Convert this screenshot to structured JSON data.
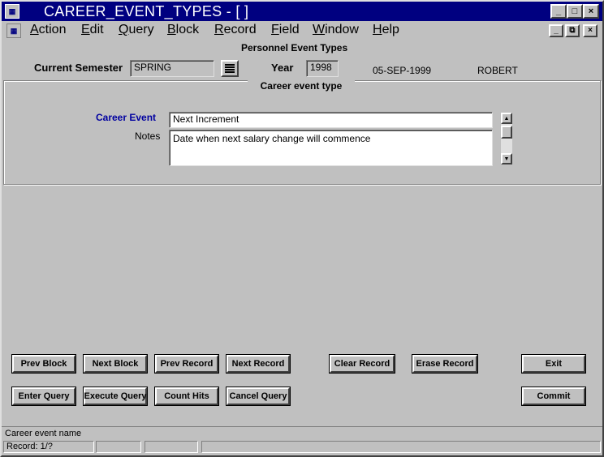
{
  "window": {
    "title": "CAREER_EVENT_TYPES - [ ]",
    "icon": "oracle-forms-icon",
    "controls": [
      "_",
      "□",
      "×"
    ]
  },
  "menubar": {
    "items": [
      {
        "accel": "A",
        "rest": "ction"
      },
      {
        "accel": "E",
        "rest": "dit"
      },
      {
        "accel": "Q",
        "rest": "uery"
      },
      {
        "accel": "B",
        "rest": "lock"
      },
      {
        "accel": "R",
        "rest": "ecord"
      },
      {
        "accel": "F",
        "rest": "ield"
      },
      {
        "accel": "W",
        "rest": "indow"
      },
      {
        "accel": "H",
        "rest": "elp"
      }
    ],
    "doc_controls": [
      "_",
      "⧉",
      "×"
    ]
  },
  "header": {
    "form_title": "Personnel Event Types",
    "semester_label": "Current Semester",
    "semester_value": "SPRING",
    "year_label": "Year",
    "year_value": "1998",
    "date": "05-SEP-1999",
    "user": "ROBERT"
  },
  "block": {
    "title": "Career event type",
    "career_event_label": "Career Event",
    "career_event_value": "Next Increment",
    "notes_label": "Notes",
    "notes_value": "Date when next salary change will commence"
  },
  "buttons": {
    "prev_block": "Prev Block",
    "next_block": "Next Block",
    "prev_record": "Prev Record",
    "next_record": "Next Record",
    "clear_record": "Clear Record",
    "erase_record": "Erase Record",
    "exit": "Exit",
    "enter_query": "Enter Query",
    "execute_query": "Execute Query",
    "count_hits": "Count Hits",
    "cancel_query": "Cancel Query",
    "commit": "Commit"
  },
  "status": {
    "hint": "Career event name",
    "record": "Record: 1/?"
  },
  "colors": {
    "titlebar": "#000080",
    "background": "#c0c0c0",
    "label_accent": "#0000a0"
  }
}
